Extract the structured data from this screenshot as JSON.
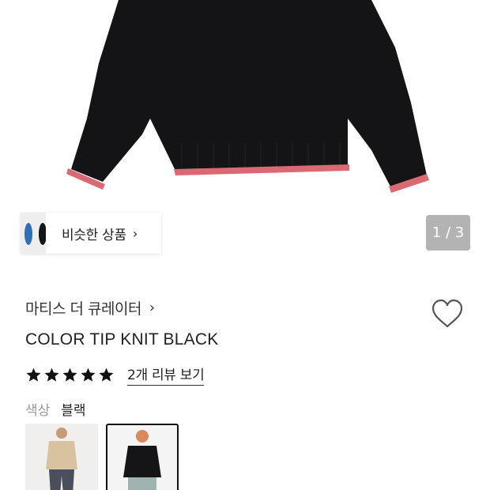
{
  "gallery": {
    "pager_text": "1 / 3",
    "colors": {
      "sweater": "#121214",
      "tip": "#d96a73",
      "background": "#ffffff"
    }
  },
  "similar": {
    "label": "비슷한 상품",
    "chevron": "›"
  },
  "product": {
    "brand": "마티스 더 큐레이터",
    "brand_chevron": "›",
    "title": "COLOR TIP KNIT BLACK",
    "rating": 5,
    "rating_max": 5,
    "review_link": "2개 리뷰 보기",
    "color_label": "색상",
    "color_value": "블랙"
  },
  "variants": [
    {
      "name": "beige",
      "selected": false
    },
    {
      "name": "black",
      "selected": true
    }
  ],
  "icons": {
    "wishlist": "heart-outline-icon",
    "star": "star-filled-icon"
  }
}
